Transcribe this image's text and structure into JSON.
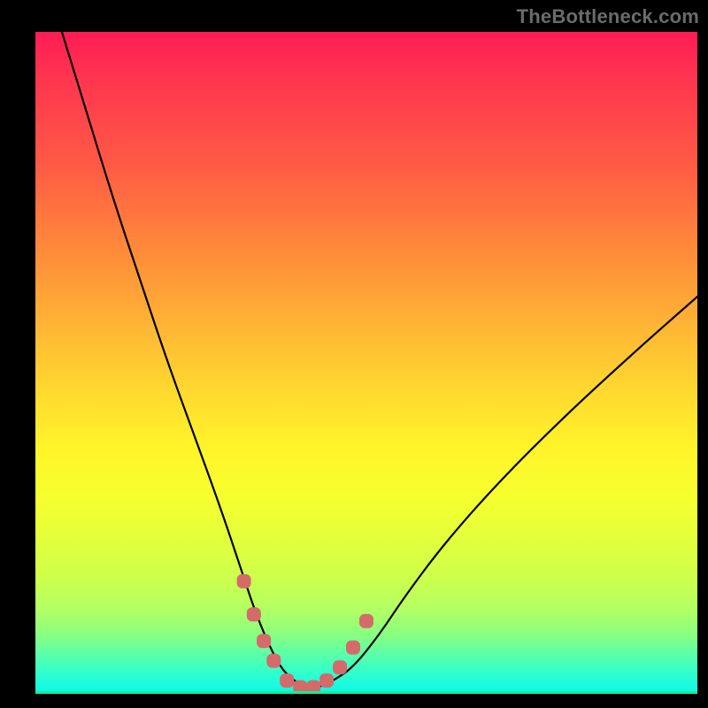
{
  "watermark": "TheBottleneck.com",
  "chart_data": {
    "type": "line",
    "title": "",
    "xlabel": "",
    "ylabel": "",
    "xlim": [
      0,
      100
    ],
    "ylim": [
      0,
      100
    ],
    "grid": false,
    "series": [
      {
        "name": "bottleneck-curve",
        "x": [
          4,
          8,
          12,
          16,
          20,
          24,
          28,
          31,
          33,
          35,
          37,
          39,
          41,
          43,
          45,
          48,
          52,
          56,
          62,
          70,
          80,
          92,
          100
        ],
        "y": [
          100,
          87,
          74,
          62,
          50,
          39,
          28,
          19,
          13,
          8,
          4,
          2,
          1,
          1,
          2,
          4,
          9,
          15,
          23,
          32,
          42,
          53,
          60
        ]
      }
    ],
    "markers": {
      "name": "highlight-points",
      "x": [
        31.5,
        33.0,
        34.5,
        36.0,
        38.0,
        40.0,
        42.0,
        44.0,
        46.0,
        48.0,
        50.0
      ],
      "y": [
        17,
        12,
        8,
        5,
        2,
        1,
        1,
        2,
        4,
        7,
        11
      ]
    },
    "colors": {
      "curve": "#000000",
      "markers": "#d46a6a",
      "gradient_top": "#ff1b55",
      "gradient_bottom": "#0cf29a"
    }
  }
}
